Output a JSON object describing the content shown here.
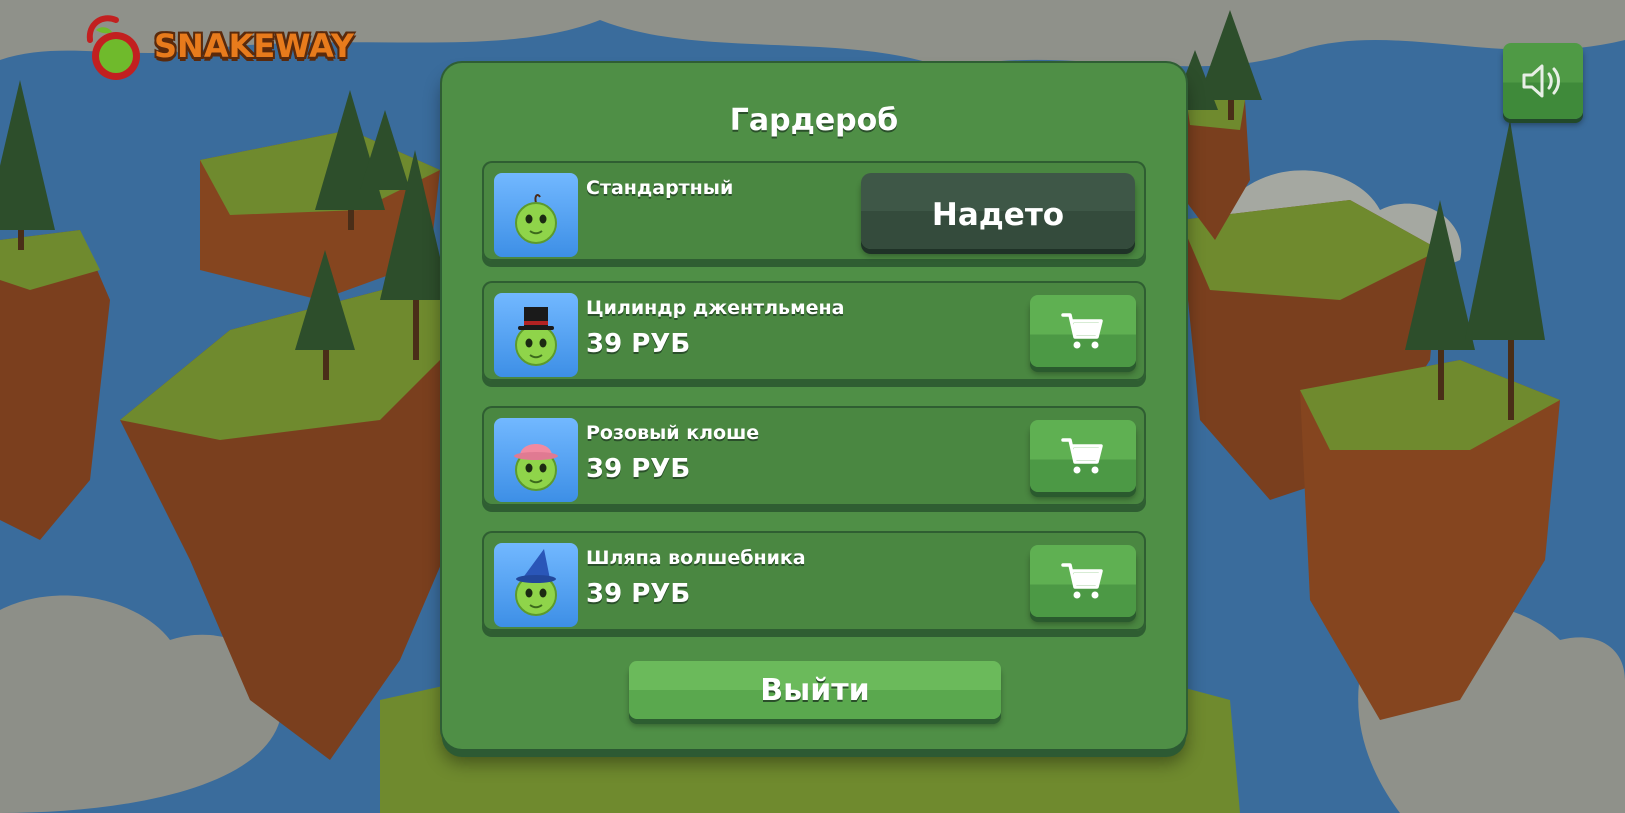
{
  "header": {
    "logo_text": "SNAKEWAY",
    "sound_icon": "speaker-icon"
  },
  "wardrobe": {
    "title": "Гардероб",
    "items": [
      {
        "name": "Стандартный",
        "price": "",
        "action": "Надето",
        "hat": "none"
      },
      {
        "name": "Цилиндр джентльмена",
        "price": "39 РУБ",
        "action_icon": "cart-icon",
        "hat": "top-hat"
      },
      {
        "name": "Розовый клоше",
        "price": "39 РУБ",
        "action_icon": "cart-icon",
        "hat": "pink-cloche"
      },
      {
        "name": "Шляпа волшебника",
        "price": "39 РУБ",
        "action_icon": "cart-icon",
        "hat": "wizard-hat"
      }
    ],
    "exit_label": "Выйти"
  },
  "colors": {
    "panel": "#4f8f46",
    "button_green": "#5fb052",
    "button_worn": "#3e5747",
    "logo_orange": "#e87b1c"
  }
}
